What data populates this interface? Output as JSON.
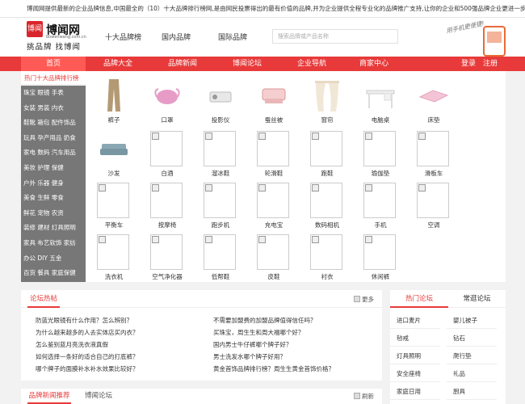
{
  "topbar": {
    "text": "博闻网提供最新的企业品牌信息,中国最全的（10）十大品牌排行榜网,是由网民投票得出的最有价值的品牌,并为企业提供全程专业化的品牌推广支持,让你的企业和500强品牌企业更进一步。"
  },
  "header": {
    "logo_icon": "博闻",
    "logo_name": "博闻网",
    "logo_url": "bowenwang.com.cn",
    "slogan": "挑品牌 找博闻",
    "nav": [
      "十大品牌榜",
      "国内品牌",
      "国际品牌"
    ],
    "search_placeholder": "搜索品牌或产品名称",
    "promo_text": "用手机更便捷!"
  },
  "mainnav": {
    "items": [
      "首页",
      "品牌大全",
      "品牌新闻",
      "博闻论坛",
      "企业导航",
      "商家中心"
    ],
    "login": "登录",
    "register": "注册"
  },
  "sidebar": {
    "title": "热门十大品牌排行榜",
    "items": [
      "珠宝 眼镜 手表",
      "女装 男装 内衣",
      "鞋靴 箱包 配件饰品",
      "玩具 孕产用品 奶食",
      "家电 数码 汽车用品",
      "美妆 护理 保健",
      "户外 乐器 健身",
      "美食 生鲜 零食",
      "鲜花 宠物 农资",
      "装修 建材 灯具照明",
      "家具 布艺软饰 家纺",
      "办公 DIY 五金",
      "百货 餐具 家庭保健"
    ]
  },
  "products": [
    {
      "label": "裤子",
      "icon": "pants-image"
    },
    {
      "label": "口罩",
      "icon": "mask-image"
    },
    {
      "label": "投影仪",
      "icon": "projector-image"
    },
    {
      "label": "蚕丝被",
      "icon": "quilt-image"
    },
    {
      "label": "窗帘",
      "icon": "curtain-image"
    },
    {
      "label": "电脑桌",
      "icon": "desk-image"
    },
    {
      "label": "床垫",
      "icon": "mattress-image"
    },
    {
      "label": "沙发",
      "icon": "sofa-image"
    },
    {
      "label": "白酒",
      "icon": "placeholder"
    },
    {
      "label": "溜冰鞋",
      "icon": "placeholder"
    },
    {
      "label": "轮滑鞋",
      "icon": "placeholder"
    },
    {
      "label": "跑鞋",
      "icon": "placeholder"
    },
    {
      "label": "瑜伽垫",
      "icon": "placeholder"
    },
    {
      "label": "滑板车",
      "icon": "placeholder"
    },
    {
      "label": "平衡车",
      "icon": "placeholder"
    },
    {
      "label": "按摩椅",
      "icon": "placeholder"
    },
    {
      "label": "跑步机",
      "icon": "placeholder"
    },
    {
      "label": "充电宝",
      "icon": "placeholder"
    },
    {
      "label": "数码相机",
      "icon": "placeholder"
    },
    {
      "label": "手机",
      "icon": "placeholder"
    },
    {
      "label": "空调",
      "icon": "placeholder"
    },
    {
      "label": "洗衣机",
      "icon": "placeholder"
    },
    {
      "label": "空气净化器",
      "icon": "placeholder"
    },
    {
      "label": "低帮鞋",
      "icon": "placeholder"
    },
    {
      "label": "皮鞋",
      "icon": "placeholder"
    },
    {
      "label": "衬衣",
      "icon": "placeholder"
    },
    {
      "label": "休闲裤",
      "icon": "placeholder"
    }
  ],
  "forum_hot": {
    "title": "论坛热帖",
    "more": "更多",
    "left": [
      "防蓝光眼镜有什么作用？怎么辨别？",
      "为什么越来越多的人去实体店买内衣？",
      "怎么鉴别蓝月亮洗衣液真假",
      "如何选择一条好的适合自己的打底裤？",
      "哪个牌子的面膜补水补水效果比较好？"
    ],
    "right": [
      "不需要加盟费的加盟品牌值得信任吗？",
      "买珠宝，周生生和周大福哪个好？",
      "国内男士牛仔裤哪个牌子好？",
      "男士洗发水哪个牌子好用？",
      "黄金首饰品牌排行榜？周生生黄金首饰价格？"
    ]
  },
  "forum_side": {
    "tab_hot": "热门论坛",
    "tab_common": "常逛论坛",
    "items": [
      "进口麦片",
      "婴儿被子",
      "毡戒",
      "钻石",
      "灯具照明",
      "爬行垫",
      "安全座椅",
      "礼品",
      "家庭日用",
      "厨具"
    ]
  },
  "news": {
    "tab_brand": "品牌新闻推荐",
    "tab_forum": "博闻论坛",
    "refresh": "刷新"
  }
}
